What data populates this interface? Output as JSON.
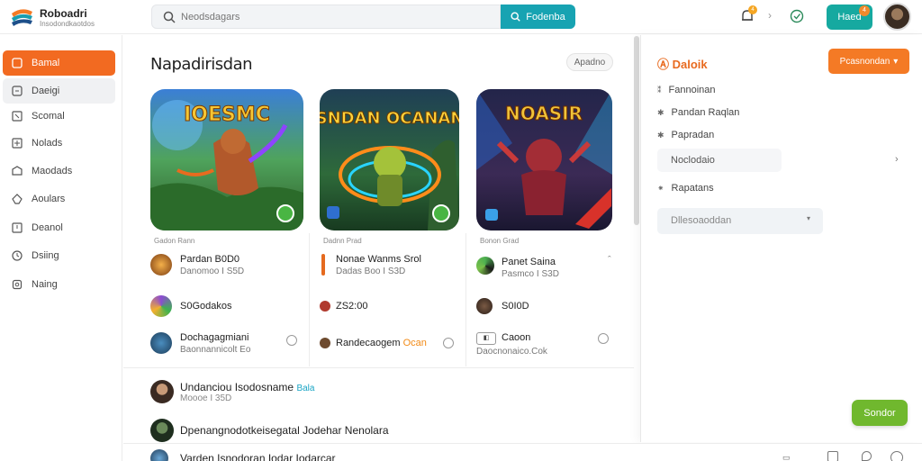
{
  "brand": {
    "name": "Roboadri",
    "subtitle": "Insodondkaotdos"
  },
  "search": {
    "placeholder": "Neodsdagars",
    "button_label": "Fodenba"
  },
  "topbar": {
    "notif_count": "4",
    "action_label": "Haed",
    "action_badge": "4"
  },
  "sidebar": {
    "items": [
      {
        "label": "Bamal",
        "icon": "home-icon"
      },
      {
        "label": "Daeigi",
        "icon": "grid-icon"
      },
      {
        "label": "Scomal",
        "icon": "square-icon"
      },
      {
        "label": "Nolads",
        "icon": "plus-square-icon"
      },
      {
        "label": "Maodads",
        "icon": "folder-icon"
      },
      {
        "label": "Aoulars",
        "icon": "tag-icon"
      },
      {
        "label": "Deanol",
        "icon": "chat-icon"
      },
      {
        "label": "Dsiing",
        "icon": "clock-icon"
      },
      {
        "label": "Naing",
        "icon": "lock-icon"
      }
    ]
  },
  "main": {
    "title": "Napadirisdan",
    "chip": "Apadno",
    "cards": [
      {
        "art_title": "IOESMC",
        "meta": "Gadon Rann",
        "creator": "Pardan B0D0",
        "creator_sub": "Danomoo I S5D",
        "row2": "S0Godakos",
        "row3_title": "Dochagagmiani",
        "row3_sub": "Baonnannicolt Eo"
      },
      {
        "art_title": "SNDAN OCANAN",
        "meta": "Dadnn Prad",
        "creator": "Nonae Wanms Srol",
        "creator_sub": "Dadas Boo I S3D",
        "row2": "ZS2:00",
        "row3_title": "Randecaogem",
        "row3_tag": "Ocan",
        "row3_sub": ""
      },
      {
        "art_title": "NOASIR",
        "meta": "Bonon Grad",
        "creator": "Panet Saina",
        "creator_sub": "Pasmco I S3D",
        "row2": "S0I0D",
        "row3_title": "Caoon",
        "row3_sub": "Daocnonaico.Cok"
      }
    ],
    "feed": [
      {
        "title": "Undanciou Isodosname",
        "tag": "Bala",
        "sub": "Moooe I 35D"
      },
      {
        "title": "Dpenangnodotkeisegatal Jodehar Nenolara",
        "tag": "",
        "sub": ""
      },
      {
        "title": "Varden Isnodoran Iodar Iodarcar",
        "tag": "",
        "sub": ""
      }
    ]
  },
  "panel": {
    "title": "Daloik",
    "button": "Pcasnondan",
    "items": [
      "Fannoinan",
      "Pandan Raqlan",
      "Papradan"
    ],
    "box": "Noclodaio",
    "item4": "Rapatans",
    "select_placeholder": "Dllesoaoddan"
  },
  "floating_button": "Sondor",
  "colors": {
    "accent": "#f26a21",
    "teal": "#17a3b2",
    "green": "#70b82e"
  }
}
